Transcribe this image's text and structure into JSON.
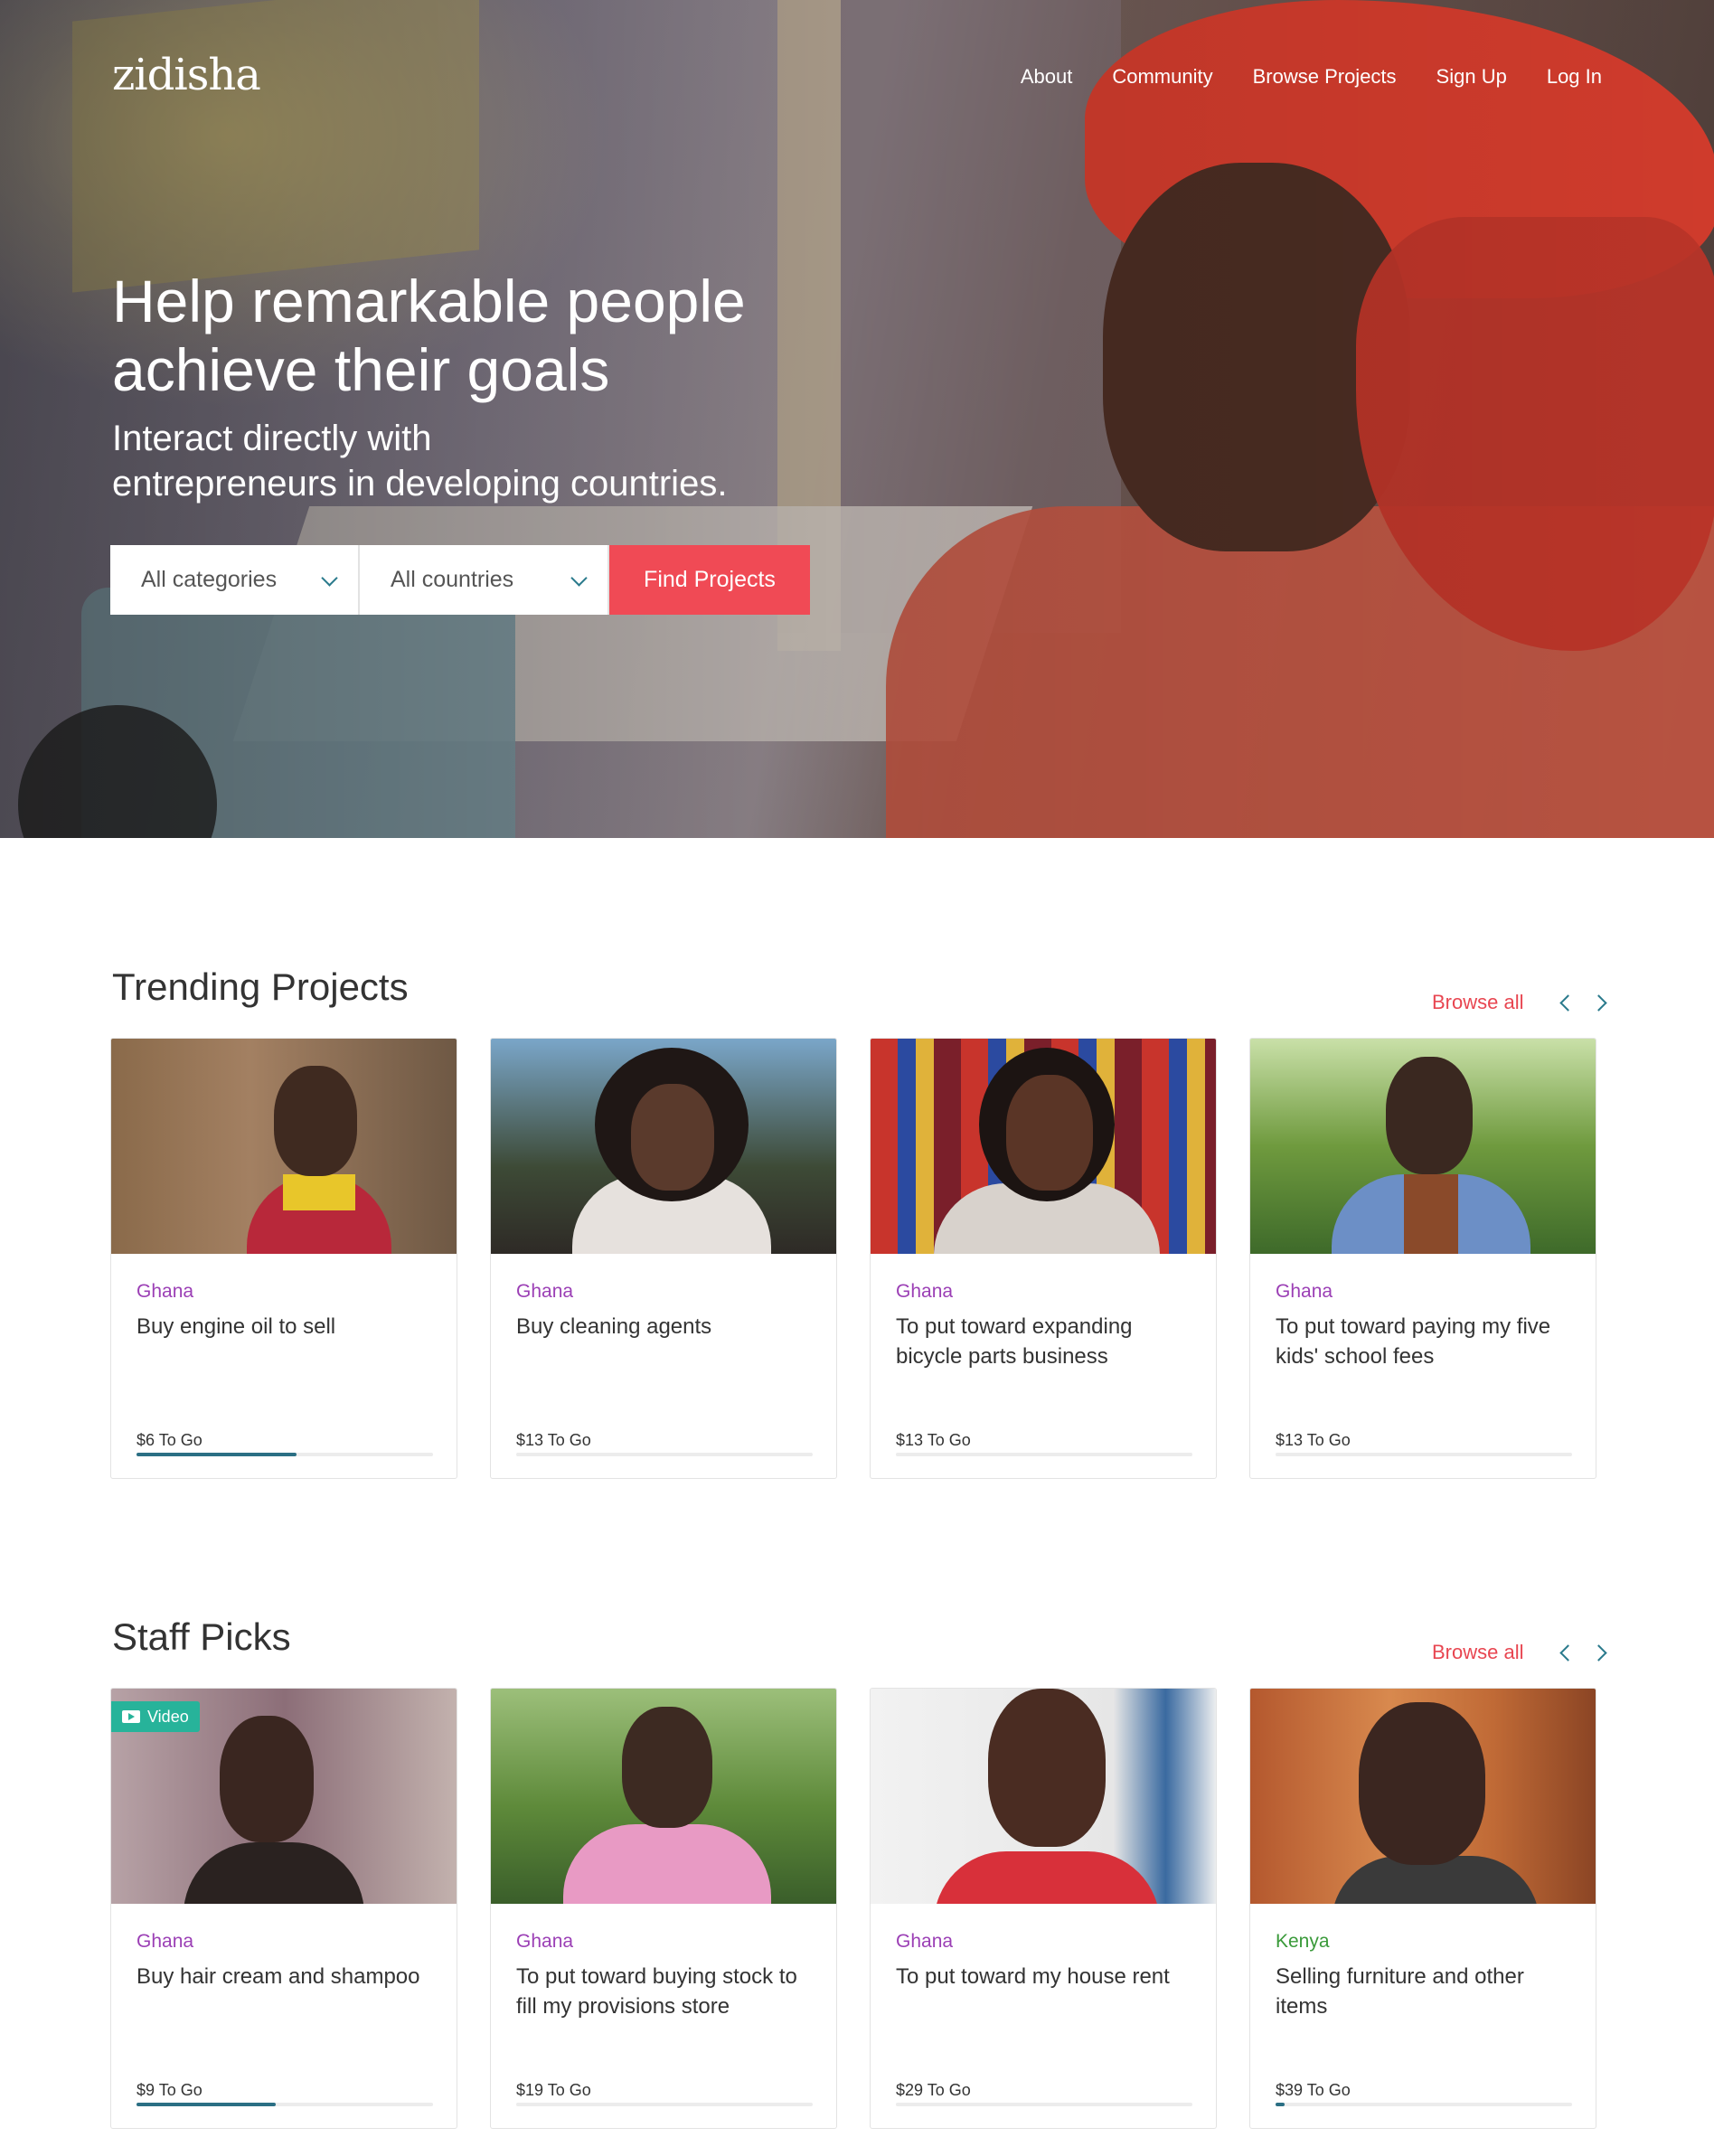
{
  "brand": {
    "logo": "zidisha"
  },
  "nav": {
    "about": "About",
    "community": "Community",
    "browse_projects": "Browse Projects",
    "sign_up": "Sign Up",
    "log_in": "Log In"
  },
  "hero": {
    "title_line1": "Help remarkable people",
    "title_line2": "achieve their goals",
    "subtitle_line1": "Interact directly with",
    "subtitle_line2": "entrepreneurs in developing countries.",
    "category_select": "All categories",
    "country_select": "All countries",
    "find_button": "Find Projects"
  },
  "colors": {
    "accent_red": "#f04a55",
    "link_red": "#e84651",
    "country_purple": "#9b3fb5",
    "country_green": "#3a9a3a",
    "progress_teal": "#2b6f84",
    "video_badge": "#27b39a"
  },
  "trending": {
    "title": "Trending Projects",
    "browse_all": "Browse all",
    "prev_icon": "chevron-left-icon",
    "next_icon": "chevron-right-icon",
    "cards": [
      {
        "country": "Ghana",
        "description": "Buy engine oil to sell",
        "to_go": "$6 To Go",
        "progress": 0.54
      },
      {
        "country": "Ghana",
        "description": "Buy cleaning agents",
        "to_go": "$13 To Go",
        "progress": 0.0
      },
      {
        "country": "Ghana",
        "description": "To put toward expanding bicycle parts business",
        "to_go": "$13 To Go",
        "progress": 0.0
      },
      {
        "country": "Ghana",
        "description": "To put toward paying my five kids' school fees",
        "to_go": "$13 To Go",
        "progress": 0.0
      }
    ]
  },
  "staff_picks": {
    "title": "Staff Picks",
    "browse_all": "Browse all",
    "prev_icon": "chevron-left-icon",
    "next_icon": "chevron-right-icon",
    "video_label": "Video",
    "cards": [
      {
        "country": "Ghana",
        "description": "Buy hair cream and shampoo",
        "to_go": "$9 To Go",
        "progress": 0.47
      },
      {
        "country": "Ghana",
        "description": "To put toward buying stock to fill my provisions store",
        "to_go": "$19 To Go",
        "progress": 0.0
      },
      {
        "country": "Ghana",
        "description": "To put toward my house rent",
        "to_go": "$29 To Go",
        "progress": 0.0
      },
      {
        "country": "Kenya",
        "description": "Selling furniture and other items",
        "to_go": "$39 To Go",
        "progress": 0.03
      }
    ]
  }
}
